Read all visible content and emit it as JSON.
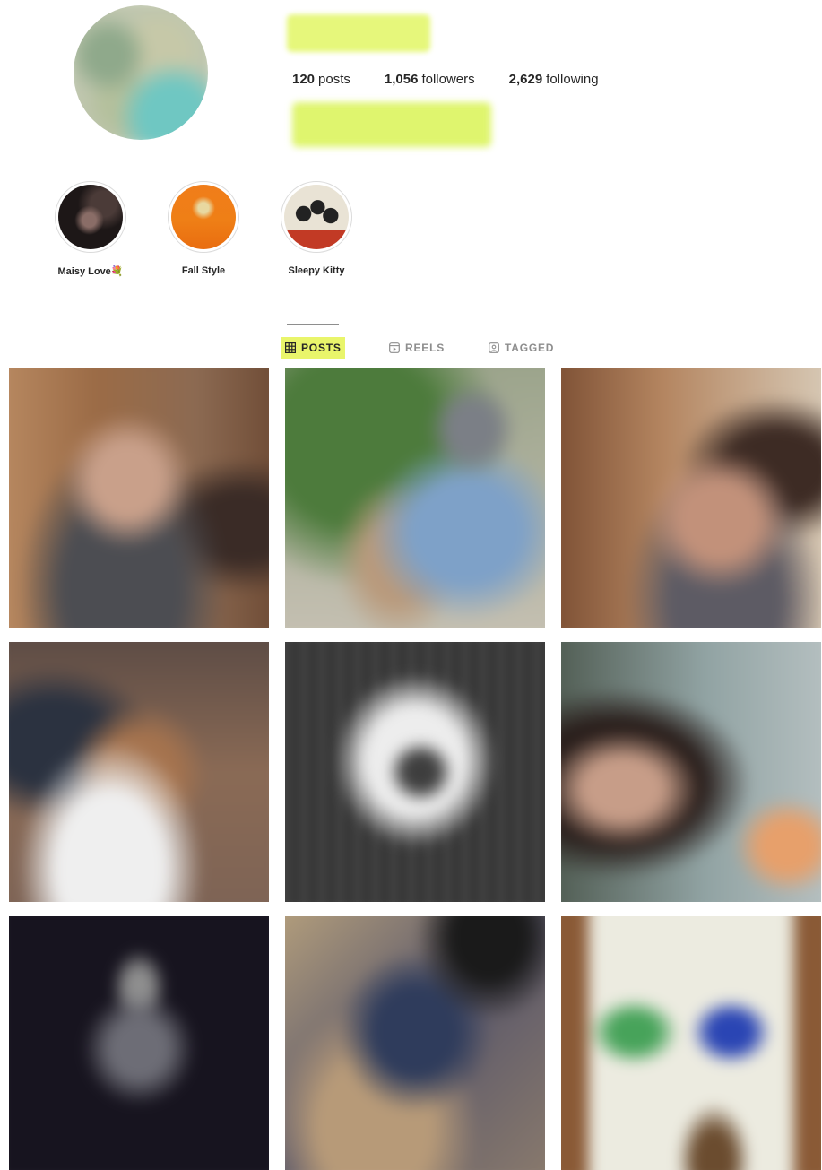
{
  "profile": {
    "stats": [
      {
        "count": "120",
        "label": "posts"
      },
      {
        "count": "1,056",
        "label": "followers"
      },
      {
        "count": "2,629",
        "label": "following"
      }
    ]
  },
  "highlights": [
    {
      "label": "Maisy Love💐"
    },
    {
      "label": "Fall Style"
    },
    {
      "label": "Sleepy Kitty"
    }
  ],
  "tabs": [
    {
      "label": "POSTS",
      "icon": "grid-icon",
      "active": true
    },
    {
      "label": "REELS",
      "icon": "reels-icon",
      "active": false
    },
    {
      "label": "TAGGED",
      "icon": "tagged-icon",
      "active": false
    }
  ],
  "colors": {
    "highlight_marker": "#e9f56b",
    "text": "#262626",
    "muted": "#8e8e8e",
    "divider": "#dbdbdb"
  }
}
